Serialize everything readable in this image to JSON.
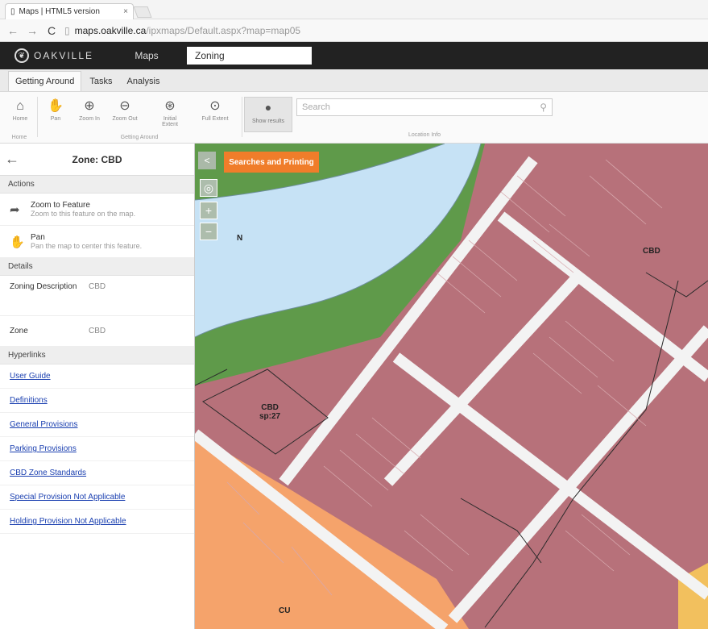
{
  "browser": {
    "tab_title": "Maps | HTML5 version",
    "tab_close": "×",
    "url_host": "maps.oakville.ca",
    "url_path": "/ipxmaps/Default.aspx?map=map05"
  },
  "header": {
    "logo_text": "OAKVILLE",
    "maps_label": "Maps",
    "map_name": "Zoning"
  },
  "ribbon": {
    "tabs": [
      "Getting Around",
      "Tasks",
      "Analysis"
    ],
    "tools": [
      {
        "label": "Home",
        "icon": "home-icon"
      },
      {
        "label": "Pan",
        "icon": "hand-icon"
      },
      {
        "label": "Zoom In",
        "icon": "zoom-in-icon"
      },
      {
        "label": "Zoom Out",
        "icon": "zoom-out-icon"
      },
      {
        "label": "Initial Extent",
        "icon": "initial-extent-icon"
      },
      {
        "label": "Full Extent",
        "icon": "full-extent-icon"
      }
    ],
    "results_label": "Show results",
    "group_home": "Home",
    "group_getting_around": "Getting Around",
    "group_location": "Location Info",
    "search_placeholder": "Search"
  },
  "panel": {
    "title": "Zone: CBD",
    "actions_header": "Actions",
    "actions": [
      {
        "title": "Zoom to Feature",
        "desc": "Zoom to this feature on the map."
      },
      {
        "title": "Pan",
        "desc": "Pan the map to center this feature."
      }
    ],
    "details_header": "Details",
    "details": [
      {
        "key": "Zoning Description",
        "value": "CBD"
      },
      {
        "key": "Zone",
        "value": "CBD"
      }
    ],
    "hyperlinks_header": "Hyperlinks",
    "hyperlinks": [
      "User Guide",
      "Definitions",
      "General Provisions",
      "Parking Provisions",
      "CBD Zone Standards",
      "Special Provision Not Applicable",
      "Holding Provision Not Applicable"
    ]
  },
  "map": {
    "searches_button": "Searches and Printing",
    "collapse_label": "<",
    "labels": {
      "n": "N",
      "cbd": "CBD",
      "cbd_sp": "CBD",
      "cbd_sp2": "sp:27",
      "cu": "CU"
    }
  },
  "colors": {
    "zone_cbd": "#b7717a",
    "zone_n": "#5f9a4a",
    "water": "#c6e2f5",
    "zone_cu": "#f5a36b",
    "road": "#f3f3f3",
    "accent": "#f07d2a"
  }
}
